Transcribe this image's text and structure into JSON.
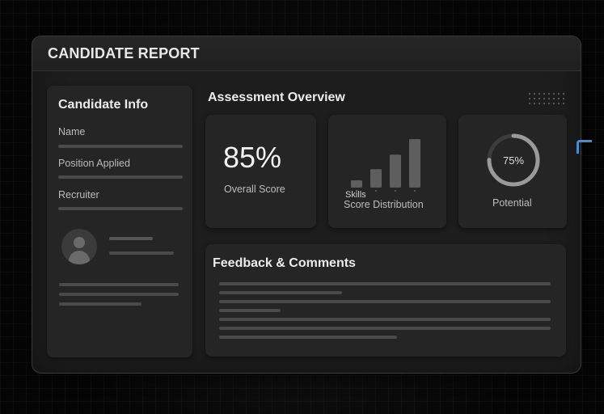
{
  "app_title": "CANDIDATE REPORT",
  "candidate_info": {
    "heading": "Candidate Info",
    "fields": [
      "Name",
      "Position Applied",
      "Recruiter"
    ]
  },
  "assessment": {
    "heading": "Assessment Overview",
    "overall": {
      "value": "85%",
      "label": "Overall Score"
    },
    "distribution": {
      "small_label": "Skills",
      "label": "Score Distribution",
      "bar_levels": [
        0.15,
        0.38,
        0.68,
        1.0
      ]
    },
    "potential": {
      "value": "75%",
      "fraction": 0.75,
      "label": "Potential"
    }
  },
  "feedback": {
    "heading": "Feedback & Comments"
  },
  "icons": {
    "avatar": "user-avatar-icon",
    "dots": "dot-grid-decoration"
  },
  "colors": {
    "accent": "#3a8ee6",
    "background": "#050505",
    "panel": "#252525"
  }
}
